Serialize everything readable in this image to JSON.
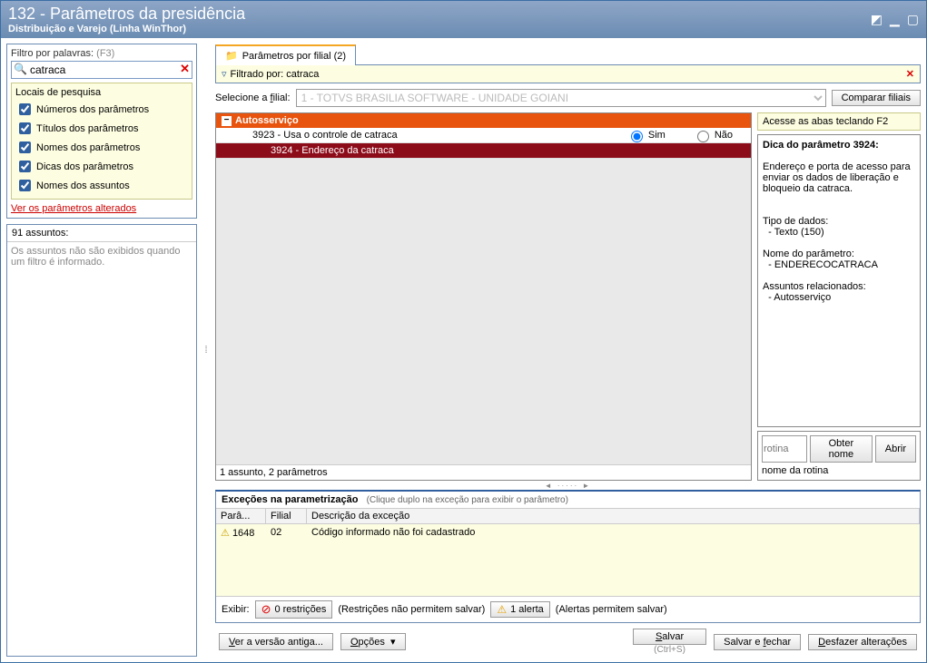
{
  "window": {
    "title": "132 - Parâmetros da presidência",
    "subtitle": "Distribuição e Varejo (Linha WinThor)"
  },
  "filter": {
    "label": "Filtro por palavras:",
    "hint": "(F3)",
    "value": "catraca"
  },
  "locais": {
    "header": "Locais de pesquisa",
    "items": [
      "Números dos parâmetros",
      "Títulos dos parâmetros",
      "Nomes dos parâmetros",
      "Dicas dos parâmetros",
      "Nomes dos assuntos"
    ],
    "link": "Ver os parâmetros alterados"
  },
  "assuntos": {
    "header": "91 assuntos:",
    "msg": "Os assuntos não são exibidos quando um filtro é informado."
  },
  "tab": {
    "label": "Parâmetros por filial  (2)"
  },
  "filterbar": {
    "text": "Filtrado por: catraca"
  },
  "filial": {
    "label": "Selecione a filial:",
    "selected": "1 - TOTVS BRASILIA SOFTWARE - UNIDADE GOIANI",
    "compareBtn": "Comparar filiais"
  },
  "grid": {
    "group": "Autosserviço",
    "rows": [
      {
        "text": "3923 - Usa o controle de catraca",
        "optYes": "Sim",
        "optNo": "Não",
        "selected": false,
        "hasOptions": true
      },
      {
        "text": "3924 - Endereço da catraca",
        "selected": true,
        "hasOptions": false
      }
    ],
    "footer": "1 assunto, 2 parâmetros"
  },
  "side": {
    "tip": "Acesse as abas teclando F2",
    "dicaTitle": "Dica do parâmetro 3924:",
    "dicaBody": "Endereço e porta de acesso para enviar os dados de liberação e bloqueio da catraca.",
    "tipoLabel": "Tipo de dados:",
    "tipoVal": "- Texto (150)",
    "nomeLabel": "Nome do parâmetro:",
    "nomeVal": "- ENDERECOCATRACA",
    "assLabel": "Assuntos relacionados:",
    "assVal": "- Autosserviço",
    "rotinaPlaceholder": "rotina",
    "obterNome": "Obter nome",
    "abrir": "Abrir",
    "rotinaDesc": "nome da rotina"
  },
  "exc": {
    "title": "Exceções na parametrização",
    "subtitle": "(Clique duplo na exceção para exibir o parâmetro)",
    "cols": {
      "c1": "Parâ...",
      "c2": "Filial",
      "c3": "Descrição da exceção"
    },
    "row": {
      "param": "1648",
      "filial": "02",
      "desc": "Código informado não foi cadastrado"
    },
    "exibir": "Exibir:",
    "restricoes": "0 restrições",
    "restrHint": "(Restrições não permitem salvar)",
    "alertas": "1 alerta",
    "alertHint": "(Alertas permitem salvar)"
  },
  "footer": {
    "versao": "Ver a versão antiga...",
    "opcoes": "Opções",
    "salvar": "Salvar",
    "salvarFechar": "Salvar e fechar",
    "desfazer": "Desfazer alterações",
    "shortcut": "(Ctrl+S)"
  }
}
